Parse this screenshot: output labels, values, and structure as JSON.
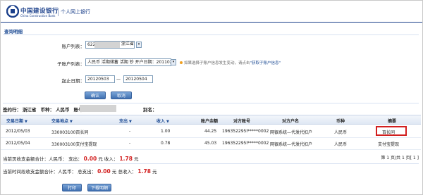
{
  "header": {
    "bank_name_cn": "中国建设银行",
    "bank_name_en": "China Construction Bank",
    "product": "个人网上银行",
    "brand_color": "#1a3f8a"
  },
  "section_title": "查询明细",
  "form": {
    "account_label": "账户列表：",
    "account_value": "622",
    "account_region": "浙江省",
    "subaccount_label": "子账户列表：",
    "subaccount_value": "人民币 活期储蓄 活期 钞 开户日期：20110225",
    "hint_text": "如果选择子账户信息发生变动，请点击",
    "hint_link": "\"获取子账户信息\"",
    "date_label": "起止日期：",
    "date_from": "20120503",
    "date_sep": "—",
    "date_to": "20120504",
    "confirm_button": "确认",
    "cancel_button": "取消"
  },
  "summary": {
    "open_label": "签约行：",
    "open_value": "浙江省",
    "currency_label": "币种：",
    "currency_value": "人民币",
    "account_label": "账号：",
    "account_value": "62",
    "alias_label": "别名："
  },
  "table": {
    "headers": {
      "date": "交易日期",
      "place": "交易地点",
      "out": "支出",
      "in": "收入",
      "balance": "账户余额",
      "counter_acct": "对方账号",
      "counter_name": "对方户名",
      "currency": "币种",
      "memo": "摘要"
    },
    "sort_mark": "▼",
    "rows": [
      {
        "date": "2012/05/03",
        "place": "330003100百长同",
        "out": "-",
        "in": "1.00",
        "balance": "44.25",
        "counter_acct": "196352295l*****0002",
        "counter_name": "网银系统—代发代扣户",
        "currency": "人民币",
        "memo": "百长同"
      },
      {
        "date": "2012/05/04",
        "place": "330003100支付宝提现",
        "out": "-",
        "in": "0.78",
        "balance": "45.03",
        "counter_acct": "196352295l*****0002",
        "counter_name": "网银系统—代发代扣户",
        "currency": "人民币",
        "memo": "支付宝提现"
      }
    ]
  },
  "pager": {
    "text": "第 1 页/共 1 页[ 1 ]"
  },
  "totals_page": {
    "label": "当前页收支金额合计：人民币：",
    "out_label": "支出：",
    "out_value": "0.00",
    "out_unit": "元",
    "in_label": "收入：",
    "in_value": "1.78",
    "in_unit": "元"
  },
  "totals_all": {
    "label": "当前时间段收支金额合计：人民币：",
    "out_label": "总支出：",
    "out_value": "0.00",
    "out_unit": "元",
    "in_label": "总收入：",
    "in_value": "1.78",
    "in_unit": "元"
  },
  "footer": {
    "print_button": "打印",
    "download_button": "下载明细"
  },
  "colors": {
    "accent": "#1d4b94",
    "amount_red": "#d21f1f"
  }
}
